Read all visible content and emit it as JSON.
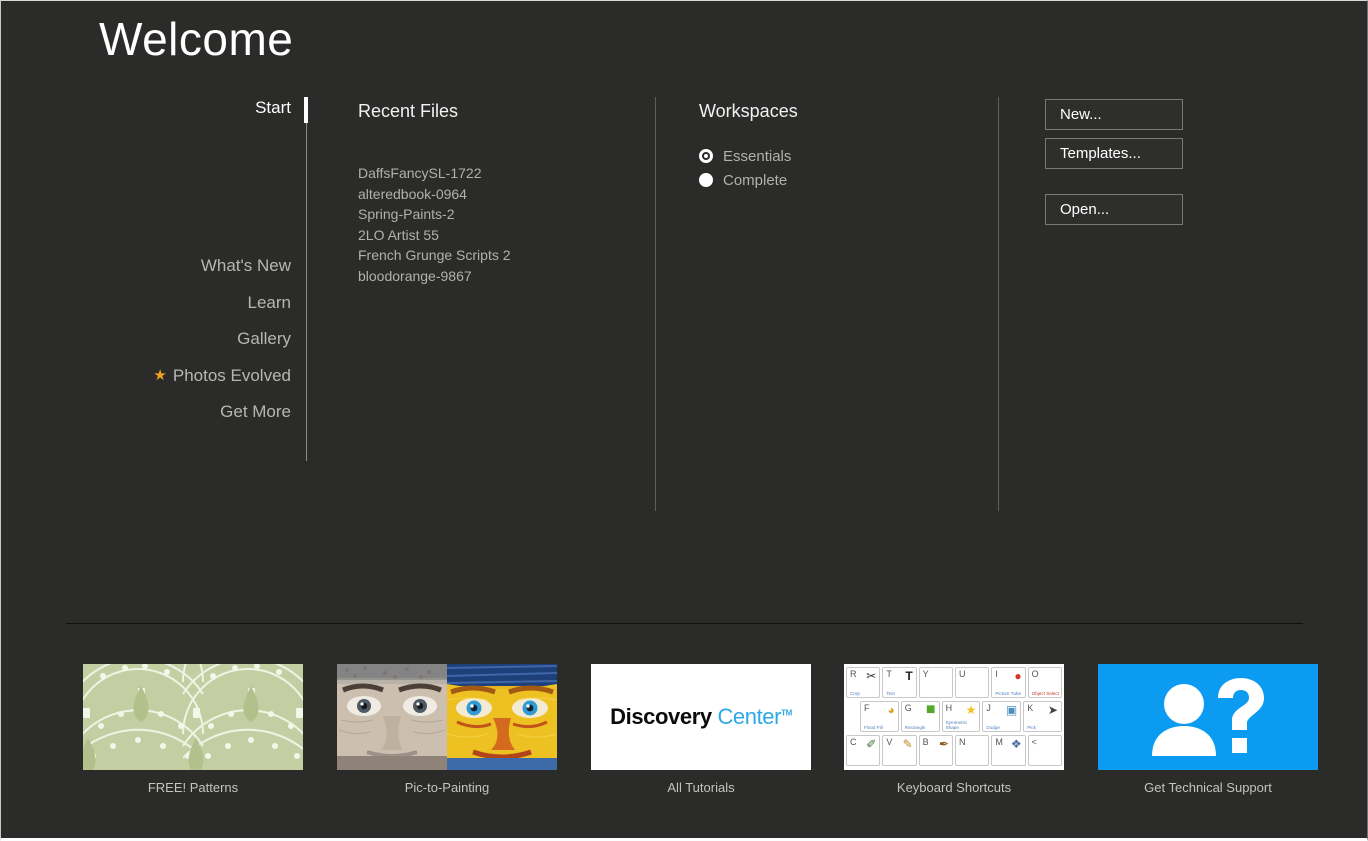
{
  "window": {
    "title": "Welcome",
    "background_color": "#2b2b29"
  },
  "sidebar": {
    "items": [
      {
        "label": "Start",
        "active": true,
        "starred": false
      },
      {
        "label": "What's New",
        "active": false,
        "starred": false
      },
      {
        "label": "Learn",
        "active": false,
        "starred": false
      },
      {
        "label": "Gallery",
        "active": false,
        "starred": false
      },
      {
        "label": "Photos Evolved",
        "active": false,
        "starred": true
      },
      {
        "label": "Get More",
        "active": false,
        "starred": false
      }
    ],
    "star_color": "#f2a11c"
  },
  "recent_files": {
    "heading": "Recent Files",
    "items": [
      "DaffsFancySL-1722",
      "alteredbook-0964",
      "Spring-Paints-2",
      "2LO Artist 55",
      "French Grunge Scripts 2",
      "bloodorange-9867"
    ]
  },
  "workspaces": {
    "heading": "Workspaces",
    "options": [
      {
        "label": "Essentials",
        "selected": true
      },
      {
        "label": "Complete",
        "selected": false
      }
    ]
  },
  "actions": {
    "new_label": "New...",
    "templates_label": "Templates...",
    "open_label": "Open..."
  },
  "tiles": [
    {
      "caption": "FREE! Patterns",
      "art": "pattern",
      "accent": "#c3cfa3"
    },
    {
      "caption": "Pic-to-Painting",
      "art": "portrait-split",
      "accent": "#e0a51d"
    },
    {
      "caption": "All Tutorials",
      "art": "discovery-center",
      "logo_first": "Discovery",
      "logo_second": "Center",
      "logo_tm": "TM",
      "accent": "#2ea8e6"
    },
    {
      "caption": "Keyboard Shortcuts",
      "art": "keyboard-chart",
      "accent": "#4f7fbf"
    },
    {
      "caption": "Get Technical Support",
      "art": "support-icon",
      "accent": "#0b9bf0"
    }
  ],
  "keyboard_chart": {
    "rows": [
      [
        {
          "letter": "R",
          "name": "Crop",
          "glyph": "✂"
        },
        {
          "letter": "T",
          "name": "Text",
          "glyph": "T"
        },
        {
          "letter": "Y",
          "name": "",
          "glyph": ""
        },
        {
          "letter": "U",
          "name": "",
          "glyph": ""
        },
        {
          "letter": "I",
          "name": "Picture Tube",
          "glyph": "●"
        },
        {
          "letter": "O",
          "name": "Object Select",
          "glyph": ""
        }
      ],
      [
        {
          "letter": "F",
          "name": "Flood Fill",
          "glyph": "◕"
        },
        {
          "letter": "G",
          "name": "Rectangle",
          "glyph": "■"
        },
        {
          "letter": "H",
          "name": "Symmetric Shape",
          "glyph": "★"
        },
        {
          "letter": "J",
          "name": "Dodge",
          "glyph": "▣"
        },
        {
          "letter": "K",
          "name": "Pick",
          "glyph": "➤"
        }
      ],
      [
        {
          "letter": "C",
          "name": "",
          "glyph": "✐"
        },
        {
          "letter": "V",
          "name": "",
          "glyph": "✎"
        },
        {
          "letter": "B",
          "name": "",
          "glyph": "✒"
        },
        {
          "letter": "N",
          "name": "",
          "glyph": ""
        },
        {
          "letter": "M",
          "name": "",
          "glyph": "❖"
        },
        {
          "letter": "<",
          "name": "",
          "glyph": ""
        }
      ]
    ]
  }
}
